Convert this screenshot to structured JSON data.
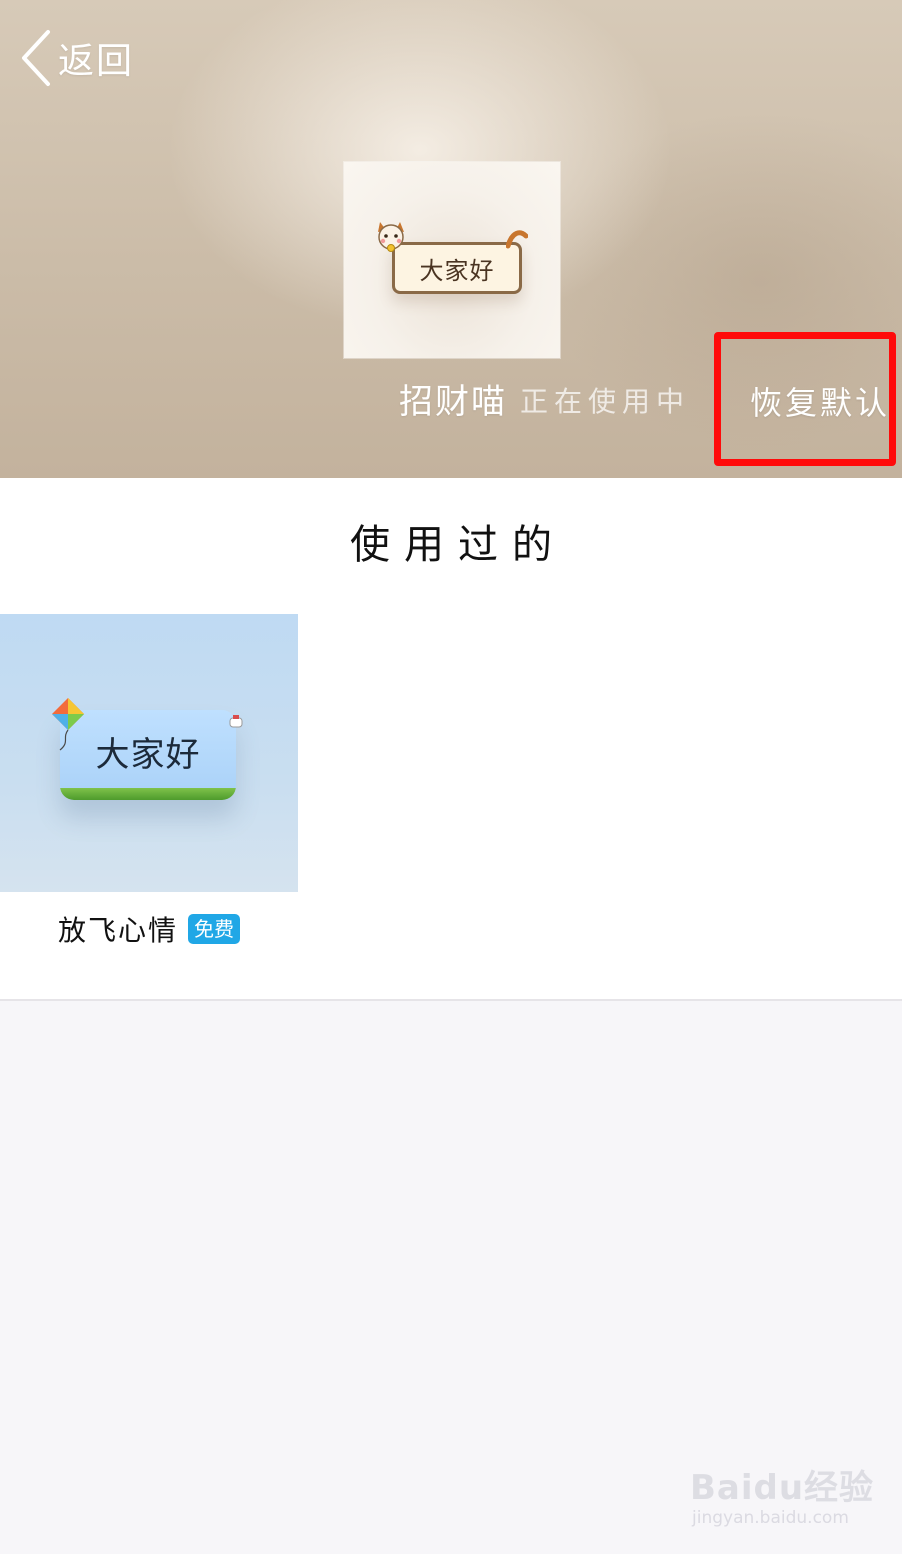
{
  "header": {
    "back_label": "返回",
    "current_theme": {
      "preview_text": "大家好",
      "name": "招财喵",
      "status": "正在使用中"
    },
    "restore_label": "恢复默认"
  },
  "used_section": {
    "title": "使用过的",
    "items": [
      {
        "preview_text": "大家好",
        "name": "放飞心情",
        "badge": "免费"
      }
    ]
  },
  "watermark": {
    "brand": "Baidu经验",
    "url": "jingyan.baidu.com"
  },
  "colors": {
    "highlight_box": "#ff0a0a",
    "free_badge": "#20a7e6",
    "header_bg": "#cbbca8"
  }
}
